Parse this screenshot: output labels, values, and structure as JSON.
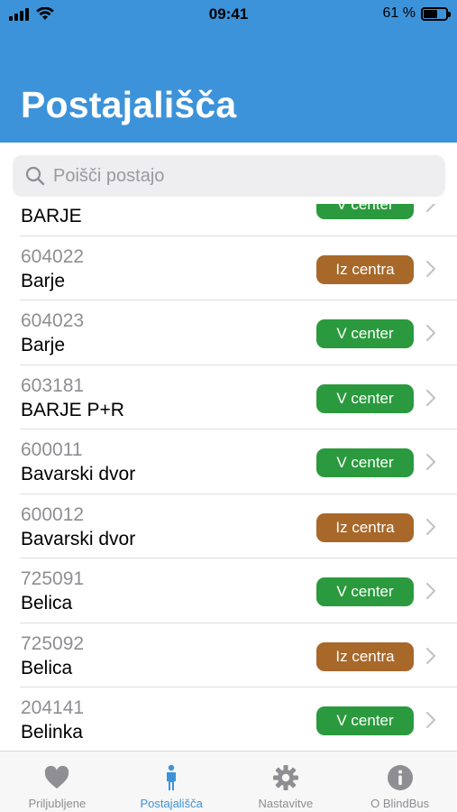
{
  "status_bar": {
    "time": "09:41",
    "battery": "61 %",
    "battery_level": 0.61
  },
  "header": {
    "title": "Postajališča"
  },
  "search": {
    "placeholder": "Poišči postajo",
    "value": ""
  },
  "colors": {
    "header": "#3d93d9",
    "v_center": "#2b9a3e",
    "iz_centra": "#a8682a",
    "tab_active": "#3d93d9",
    "tab_inactive": "#8e8e93"
  },
  "stops": [
    {
      "code": "",
      "name": "BARJE",
      "direction": "V center",
      "direction_type": "v_center"
    },
    {
      "code": "604022",
      "name": "Barje",
      "direction": "Iz centra",
      "direction_type": "iz_centra"
    },
    {
      "code": "604023",
      "name": "Barje",
      "direction": "V center",
      "direction_type": "v_center"
    },
    {
      "code": "603181",
      "name": "BARJE P+R",
      "direction": "V center",
      "direction_type": "v_center"
    },
    {
      "code": "600011",
      "name": "Bavarski dvor",
      "direction": "V center",
      "direction_type": "v_center"
    },
    {
      "code": "600012",
      "name": "Bavarski dvor",
      "direction": "Iz centra",
      "direction_type": "iz_centra"
    },
    {
      "code": "725091",
      "name": "Belica",
      "direction": "V center",
      "direction_type": "v_center"
    },
    {
      "code": "725092",
      "name": "Belica",
      "direction": "Iz centra",
      "direction_type": "iz_centra"
    },
    {
      "code": "204141",
      "name": "Belinka",
      "direction": "V center",
      "direction_type": "v_center"
    }
  ],
  "tabs": [
    {
      "label": "Priljubljene",
      "icon": "heart-icon",
      "active": false
    },
    {
      "label": "Postajališča",
      "icon": "person-icon",
      "active": true
    },
    {
      "label": "Nastavitve",
      "icon": "gear-icon",
      "active": false
    },
    {
      "label": "O BlindBus",
      "icon": "info-icon",
      "active": false
    }
  ]
}
